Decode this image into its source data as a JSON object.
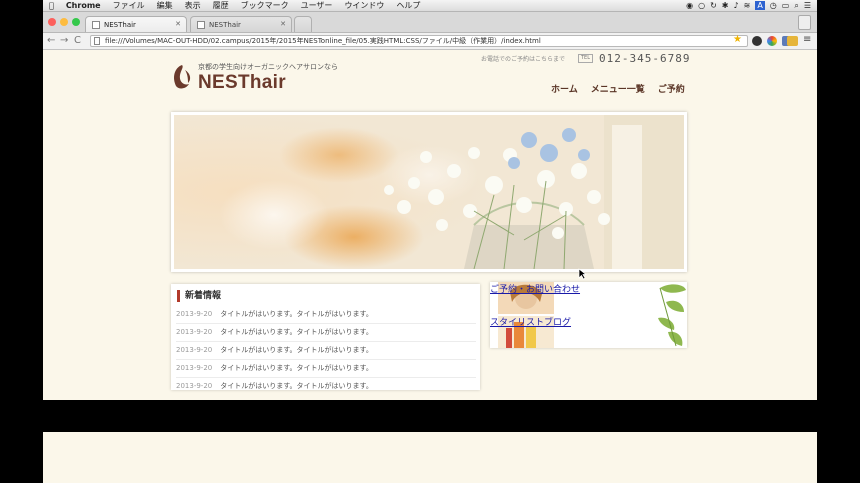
{
  "menubar": {
    "app_name": "Chrome",
    "items": [
      "ファイル",
      "編集",
      "表示",
      "履歴",
      "ブックマーク",
      "ユーザー",
      "ウインドウ",
      "ヘルプ"
    ]
  },
  "tabs": [
    {
      "label": "NESThair",
      "active": true
    },
    {
      "label": "NESThair",
      "active": false
    }
  ],
  "address": {
    "url": "file:///Volumes/MAC-OUT-HDD/02.campus/2015年/2015年NESTonline_file/05.実践HTML:CSS/ファイル/中級（作業用）/index.html"
  },
  "colors": {
    "brand": "#6b3a2c",
    "accent": "#b23a2a",
    "page_bg": "#fbf7ea"
  },
  "site": {
    "tagline": "京都の学生向けオーガニックヘアサロンなら",
    "brand": "NESThair",
    "phone_note": "お電話でのご予約はこちらまで",
    "tel_label": "TEL",
    "phone": "012-345-6789",
    "nav": [
      "ホーム",
      "メニュー一覧",
      "ご予約"
    ]
  },
  "news": {
    "title": "新着情報",
    "items": [
      {
        "date": "2013-9-20",
        "title": "タイトルがはいります。タイトルがはいります。"
      },
      {
        "date": "2013-9-20",
        "title": "タイトルがはいります。タイトルがはいります。"
      },
      {
        "date": "2013-9-20",
        "title": "タイトルがはいります。タイトルがはいります。"
      },
      {
        "date": "2013-9-20",
        "title": "タイトルがはいります。タイトルがはいります。"
      },
      {
        "date": "2013-9-20",
        "title": "タイトルがはいります。タイトルがはいります。"
      }
    ]
  },
  "side": {
    "contact_link": "ご予約・お問い合わせ",
    "blog_link": "スタイリストブログ"
  }
}
